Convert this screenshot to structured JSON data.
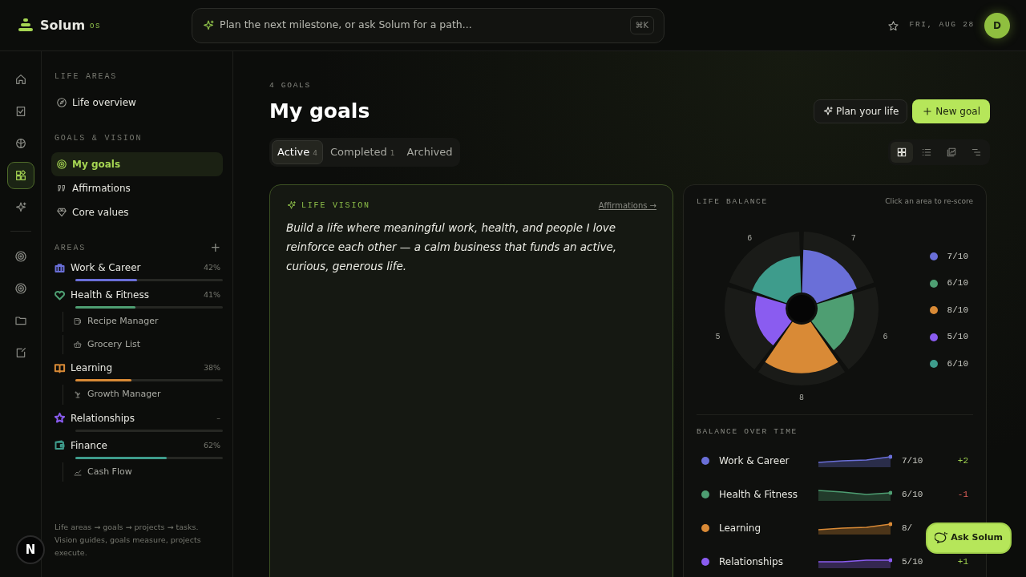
{
  "brand": {
    "name": "Solum",
    "suffix": "OS"
  },
  "search": {
    "placeholder": "Plan the next milestone, or ask Solum for a path...",
    "shortcut": "⌘K"
  },
  "header": {
    "date": "FRI, AUG 28",
    "avatar": "D"
  },
  "rail": {
    "items": [
      {
        "selected": false
      },
      {
        "selected": false
      },
      {
        "selected": false
      },
      {
        "selected": true
      },
      {
        "selected": false
      },
      {
        "selected": false
      },
      {
        "selected": false
      },
      {
        "selected": false
      },
      {
        "selected": false
      }
    ],
    "dev_badge": "N"
  },
  "sidebar": {
    "sections": [
      {
        "title": "LIFE AREAS",
        "items": [
          {
            "label": "Life overview",
            "selected": false
          }
        ]
      },
      {
        "title": "GOALS & VISION",
        "items": [
          {
            "label": "My goals",
            "selected": true
          },
          {
            "label": "Affirmations",
            "selected": false
          },
          {
            "label": "Core values",
            "selected": false
          }
        ]
      }
    ],
    "areas_title": "AREAS",
    "add": "+",
    "areas": [
      {
        "label": "Work & Career",
        "percent": "42%",
        "level": 0.42,
        "color": "#6a6fd8"
      },
      {
        "label": "Health & Fitness",
        "percent": "41%",
        "level": 0.41,
        "color": "#4e9e72",
        "children": [
          {
            "label": "Recipe Manager"
          },
          {
            "label": "Grocery List"
          }
        ]
      },
      {
        "label": "Learning",
        "percent": "38%",
        "level": 0.38,
        "color": "#d98a36",
        "children": [
          {
            "label": "Growth Manager"
          }
        ]
      },
      {
        "label": "Relationships",
        "percent": "–",
        "level": 0,
        "color": "#8a5cf0"
      },
      {
        "label": "Finance",
        "percent": "62%",
        "level": 0.62,
        "color": "#3e9c8c",
        "children": [
          {
            "label": "Cash Flow"
          }
        ]
      }
    ],
    "footer": "Life areas → goals → projects → tasks. Vision guides, goals measure, projects execute."
  },
  "page": {
    "eyebrow": "4 GOALS",
    "title": "My goals",
    "tabs": [
      {
        "label": "Active",
        "count": "4",
        "selected": true
      },
      {
        "label": "Completed",
        "count": "1",
        "selected": false
      },
      {
        "label": "Archived",
        "selected": false
      }
    ],
    "actions": [
      {
        "label": "Plan your life",
        "kind": "secondary"
      },
      {
        "label": "New goal",
        "kind": "primary"
      }
    ],
    "views": [
      {
        "selected": true
      },
      {
        "selected": false
      },
      {
        "selected": false
      },
      {
        "selected": false
      }
    ]
  },
  "vision": {
    "title": "LIFE VISION",
    "link": "Affirmations →",
    "text": "Build a life where meaningful work, health, and people I love reinforce each other — a calm business that funds an active, curious, generous life."
  },
  "life_balance": {
    "title": "LIFE BALANCE",
    "hint": "Click an area to re-score",
    "wheel": [
      {
        "label": "7",
        "color": "#6a6fd8"
      },
      {
        "label": "6",
        "color": "#4e9e72"
      },
      {
        "label": "8",
        "color": "#d98a36"
      },
      {
        "label": "5",
        "color": "#8a5cf0"
      },
      {
        "label": "6",
        "color": "#3e9c8c"
      }
    ],
    "legend": [
      {
        "color": "#6a6fd8",
        "score": "7/10"
      },
      {
        "color": "#4e9e72",
        "score": "6/10"
      },
      {
        "color": "#d98a36",
        "score": "8/10"
      },
      {
        "color": "#8a5cf0",
        "score": "5/10"
      },
      {
        "color": "#3e9c8c",
        "score": "6/10"
      }
    ],
    "over_time_title": "BALANCE OVER TIME",
    "rows": [
      {
        "name": "Work & Career",
        "color": "#6a6fd8",
        "score": "7/10",
        "delta": "+2",
        "negative": false
      },
      {
        "name": "Health & Fitness",
        "color": "#4e9e72",
        "score": "6/10",
        "delta": "-1",
        "negative": true
      },
      {
        "name": "Learning",
        "color": "#d98a36",
        "score": "8/"
      },
      {
        "name": "Relationships",
        "color": "#8a5cf0",
        "score": "5/10",
        "delta": "+1",
        "negative": false
      }
    ]
  },
  "assistant": {
    "label": "Ask Solum"
  }
}
